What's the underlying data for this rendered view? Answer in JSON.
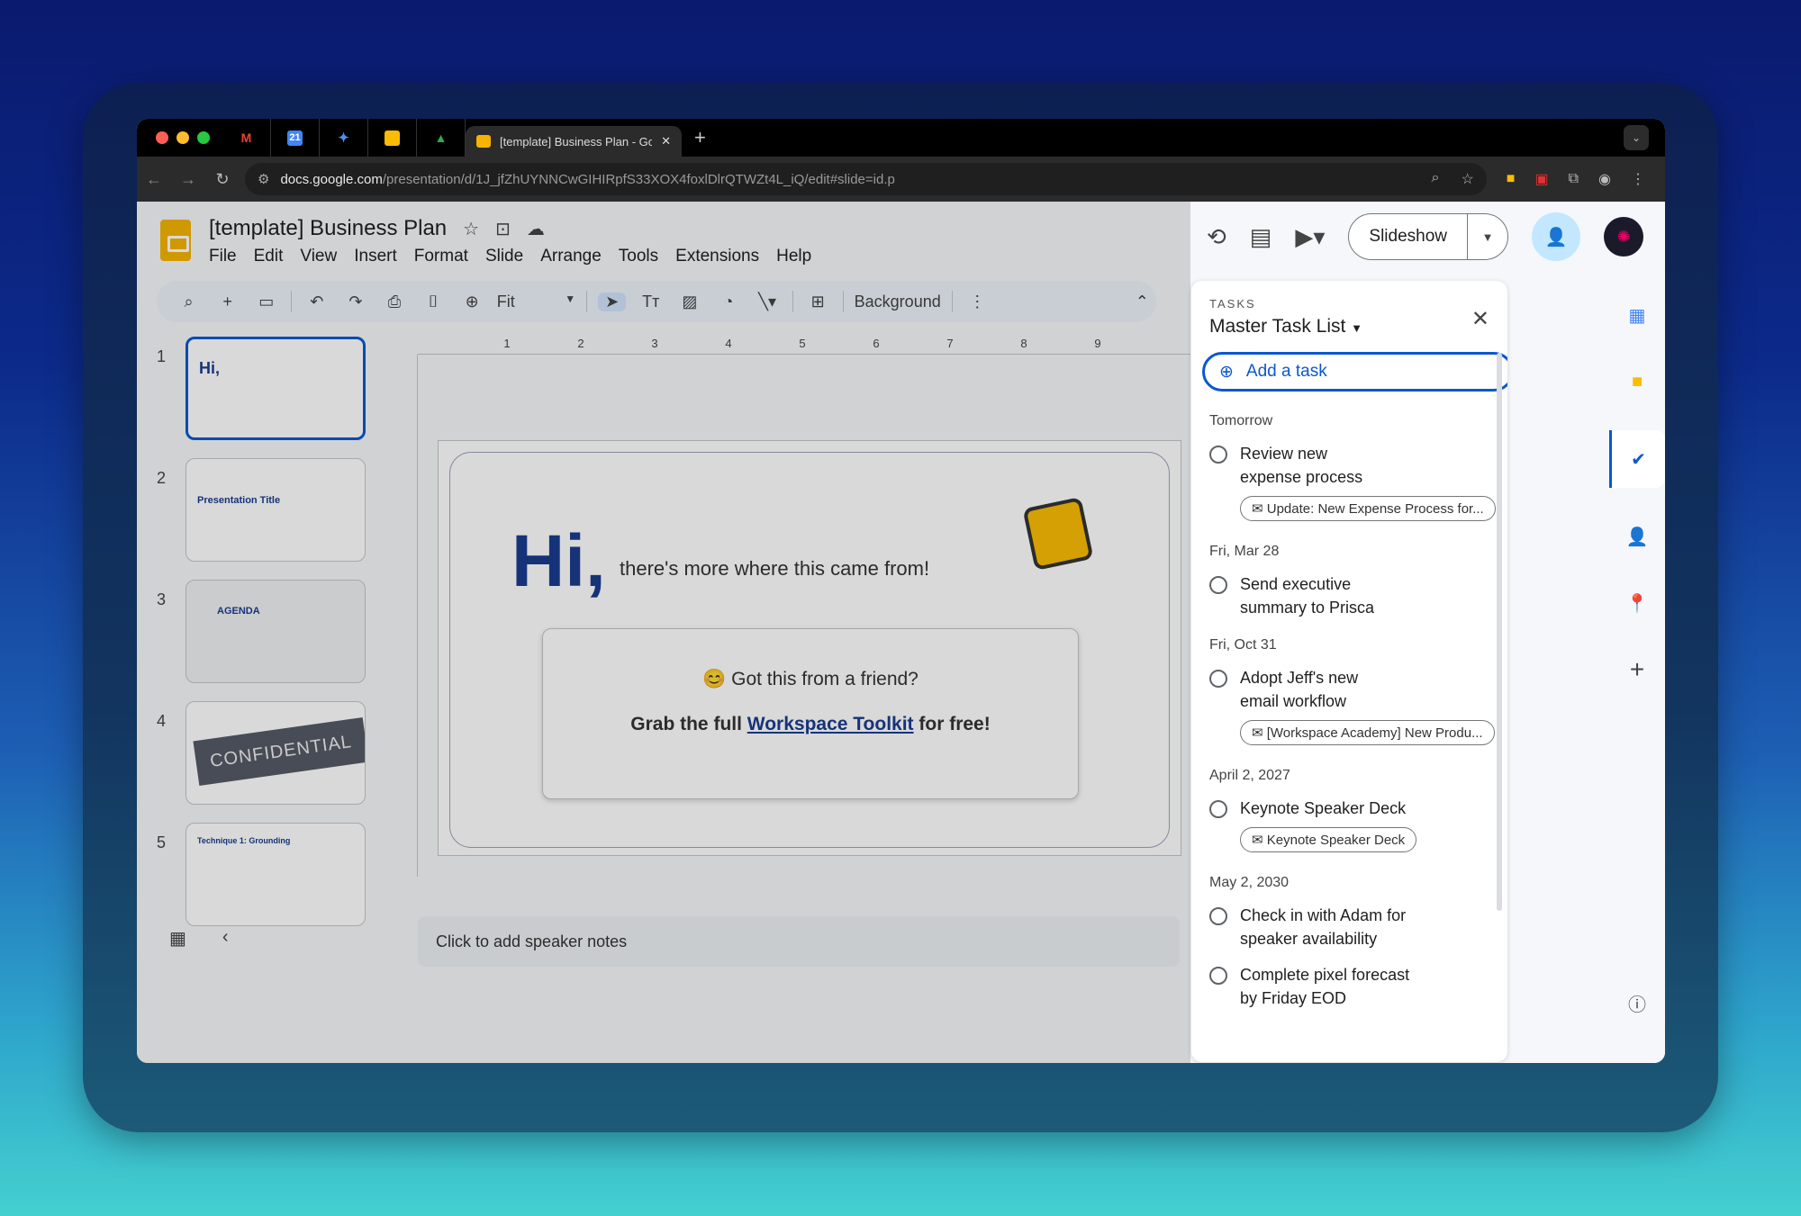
{
  "browser": {
    "tab_title": "[template] Business Plan - Google Slides",
    "new_tab": "+",
    "url_host": "docs.google.com",
    "url_path": "/presentation/d/1J_jfZhUYNNCwGIHIRpfS33XOX4foxlDlrQTWZt4L_iQ/edit#slide=id.p"
  },
  "doc": {
    "title": "[template] Business Plan",
    "menus": [
      "File",
      "Edit",
      "View",
      "Insert",
      "Format",
      "Slide",
      "Arrange",
      "Tools",
      "Extensions",
      "Help"
    ]
  },
  "header": {
    "slideshow": "Slideshow"
  },
  "toolbar": {
    "zoom": "Fit",
    "background": "Background"
  },
  "slides": [
    {
      "num": "1",
      "caption": "Hi,"
    },
    {
      "num": "2",
      "caption": "Presentation Title"
    },
    {
      "num": "3",
      "caption": "AGENDA"
    },
    {
      "num": "4",
      "caption": "CONFIDENTIAL"
    },
    {
      "num": "5",
      "caption": "Technique 1: Grounding"
    }
  ],
  "ruler": [
    "1",
    "2",
    "3",
    "4",
    "5",
    "6",
    "7",
    "8",
    "9"
  ],
  "slide": {
    "hi": "Hi,",
    "sub": "there's more where this came from!",
    "question": "😊 Got this from a friend?",
    "grab_pre": "Grab the full ",
    "grab_link": "Workspace Toolkit",
    "grab_post": " for free!"
  },
  "notes": "Click to add speaker notes",
  "tasks": {
    "label": "TASKS",
    "list": "Master Task List",
    "add": "Add a task",
    "groups": [
      {
        "date": "Tomorrow",
        "items": [
          {
            "title": "Review new expense process",
            "chip": "Update: New Expense Process for..."
          }
        ]
      },
      {
        "date": "Fri, Mar 28",
        "items": [
          {
            "title": "Send executive summary to Prisca",
            "chip": ""
          }
        ]
      },
      {
        "date": "Fri, Oct 31",
        "items": [
          {
            "title": "Adopt Jeff's new email workflow",
            "chip": "[Workspace Academy] New Produ..."
          }
        ]
      },
      {
        "date": "April 2, 2027",
        "items": [
          {
            "title": "Keynote Speaker Deck",
            "chip": "Keynote Speaker Deck"
          }
        ]
      },
      {
        "date": "May 2, 2030",
        "items": [
          {
            "title": "Check in with Adam for speaker availability",
            "chip": ""
          },
          {
            "title": "Complete pixel forecast by Friday EOD",
            "chip": ""
          }
        ]
      }
    ]
  },
  "colors": {
    "accent": "#0b57d0",
    "slides_yellow": "#f5b400",
    "brand_navy": "#1a3c8f"
  }
}
